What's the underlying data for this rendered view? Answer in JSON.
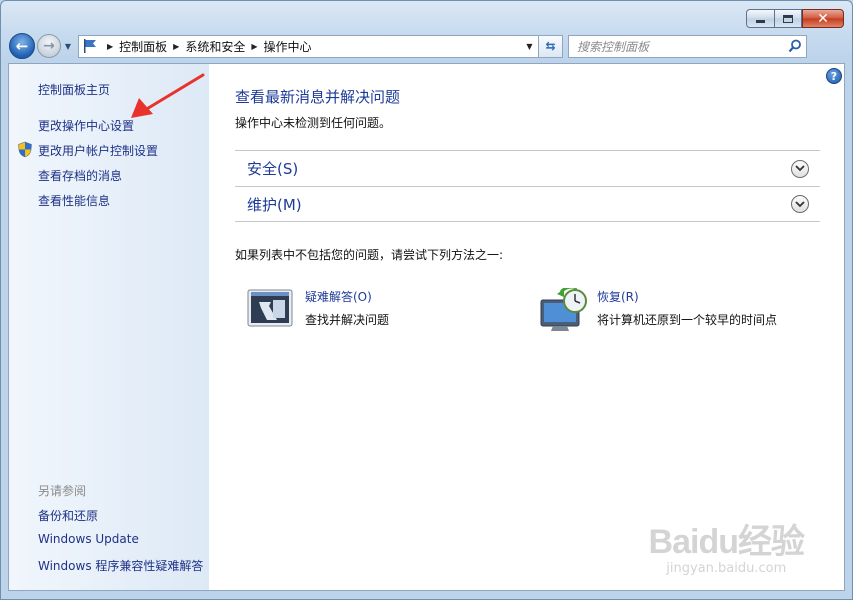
{
  "window": {
    "caption_buttons": [
      "minimize",
      "maximize",
      "close"
    ]
  },
  "nav": {
    "breadcrumbs": [
      "控制面板",
      "系统和安全",
      "操作中心"
    ],
    "search_placeholder": "搜索控制面板"
  },
  "sidebar": {
    "home_link": "控制面板主页",
    "links": [
      "更改操作中心设置",
      "更改用户帐户控制设置",
      "查看存档的消息",
      "查看性能信息"
    ],
    "see_also_title": "另请参阅",
    "see_also": [
      "备份和还原",
      "Windows Update",
      "Windows 程序兼容性疑难解答"
    ]
  },
  "main": {
    "title": "查看最新消息并解决问题",
    "subtitle": "操作中心未检测到任何问题。",
    "sections": [
      "安全(S)",
      "维护(M)"
    ],
    "prompt": "如果列表中不包括您的问题，请尝试下列方法之一:",
    "tools": [
      {
        "label": "疑难解答(O)",
        "description": "查找并解决问题",
        "icon": "troubleshoot-icon"
      },
      {
        "label": "恢复(R)",
        "description": "将计算机还原到一个较早的时间点",
        "icon": "recovery-icon"
      }
    ]
  },
  "watermark": {
    "main": "Baidu经验",
    "sub": "jingyan.baidu.com"
  },
  "colors": {
    "link": "#1e3b98",
    "annotation_arrow": "#e8322b"
  }
}
